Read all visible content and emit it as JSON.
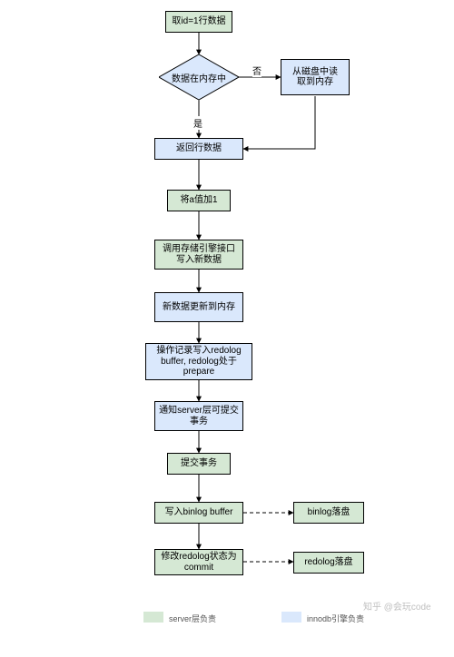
{
  "nodes": {
    "n1": "取id=1行数据",
    "d1": "数据在内存中",
    "d1_yes": "是",
    "d1_no": "否",
    "n2": "从磁盘中读\n取到内存",
    "n3": "返回行数据",
    "n4": "将a值加1",
    "n5": "调用存储引擎接口写入新数据",
    "n6": "新数据更新到内存",
    "n7": "操作记录写入redolog buffer, redolog处于prepare",
    "n8": "通知server层可提交事务",
    "n9": "提交事务",
    "n10": "写入binlog buffer",
    "n11": "binlog落盘",
    "n12": "修改redolog状态为commit",
    "n13": "redolog落盘"
  },
  "legend": {
    "server": "server层负责",
    "innodb": "innodb引擎负责"
  },
  "watermark": "知乎 @会玩code",
  "colors": {
    "green": "#d5e8d4",
    "blue": "#dae8fc"
  }
}
